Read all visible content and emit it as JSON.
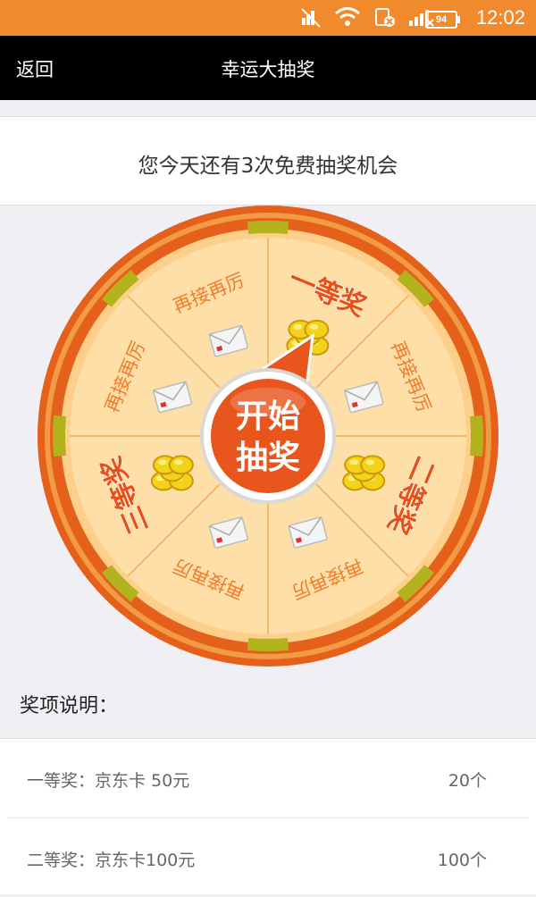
{
  "status_bar": {
    "icons": [
      "mute-icon",
      "wifi-icon",
      "sim-icon",
      "signal-icon"
    ],
    "battery": "94",
    "clock": "12:02"
  },
  "header": {
    "back_label": "返回",
    "title": "幸运大抽奖"
  },
  "notice": {
    "text": "您今天还有3次免费抽奖机会"
  },
  "wheel": {
    "segments": [
      {
        "label": "一等奖",
        "icon": "coin-stack-icon"
      },
      {
        "label": "再接再厉",
        "icon": "envelope-icon"
      },
      {
        "label": "二等奖",
        "icon": "coin-stack-icon"
      },
      {
        "label": "再接再厉",
        "icon": "envelope-icon"
      },
      {
        "label": "再接再厉",
        "icon": "envelope-icon"
      },
      {
        "label": "三等奖",
        "icon": "coin-stack-icon"
      },
      {
        "label": "再接再厉",
        "icon": "envelope-icon"
      },
      {
        "label": "再接再厉",
        "icon": "envelope-icon"
      }
    ],
    "start_label_line1": "开始",
    "start_label_line2": "抽奖",
    "colors": {
      "outer_ring": "#e5601a",
      "inner_ring": "#f7a64a",
      "segment_fill": "#fedfa8",
      "segment_label": "#f07d2e",
      "prize_label": "#e8501a",
      "rim_marker": "#b3b31e",
      "button": "#e8551d"
    }
  },
  "rules": {
    "title": "奖项说明：",
    "items": [
      {
        "name": "一等奖：京东卡 50元",
        "count": "20个"
      },
      {
        "name": "二等奖：京东卡100元",
        "count": "100个"
      }
    ]
  }
}
